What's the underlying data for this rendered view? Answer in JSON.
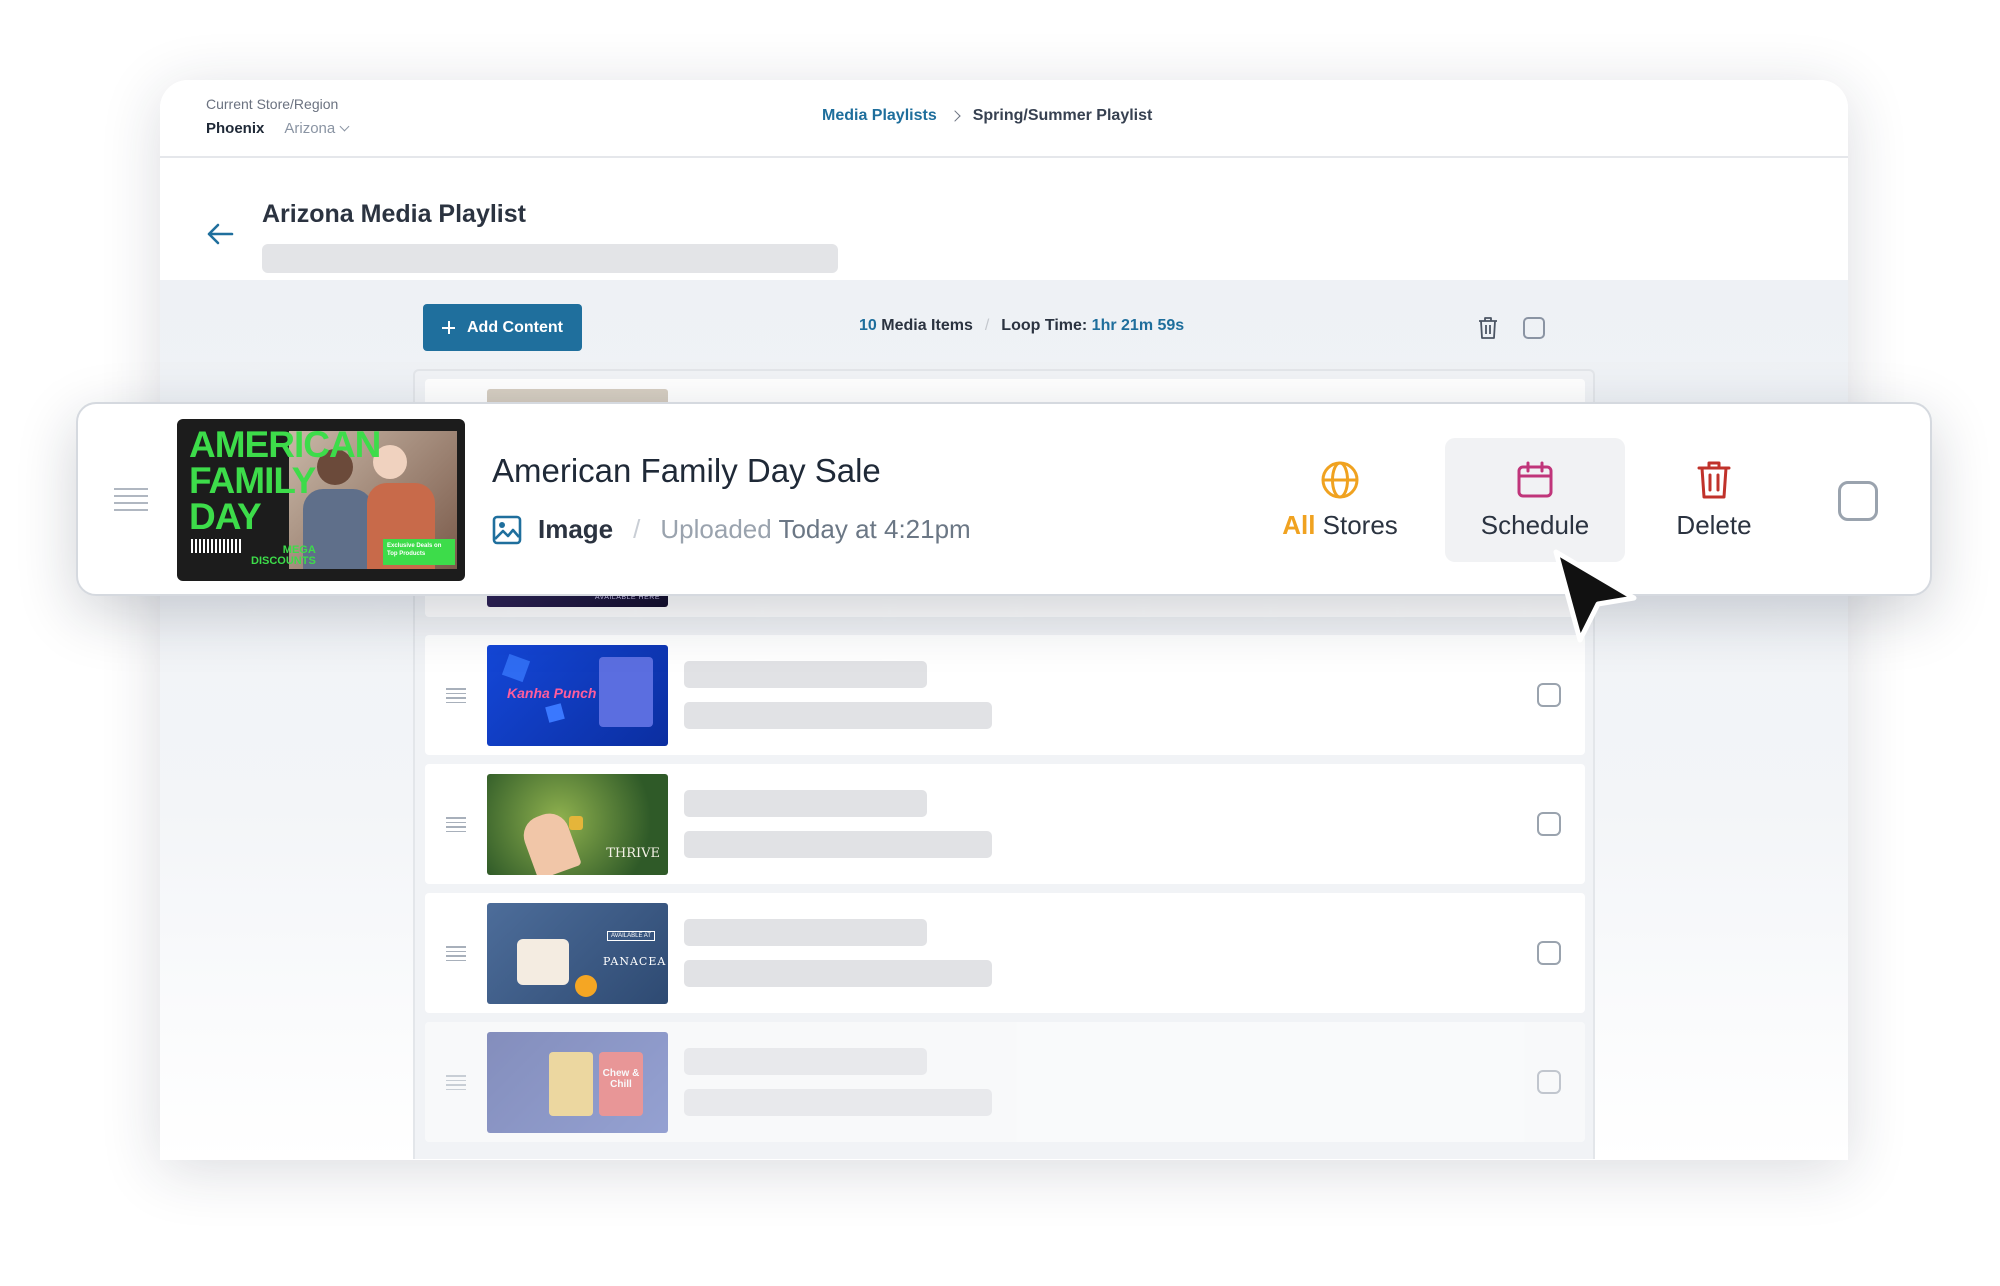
{
  "topbar": {
    "region_label": "Current Store/Region",
    "city": "Phoenix",
    "state": "Arizona",
    "breadcrumb": {
      "parent": "Media Playlists",
      "current": "Spring/Summer Playlist"
    }
  },
  "header": {
    "title": "Arizona Media Playlist"
  },
  "toolbar": {
    "add_label": "Add Content",
    "media_count": "10",
    "media_label": "Media Items",
    "loop_label": "Loop Time:",
    "loop_value": "1hr 21m 59s"
  },
  "selected_item": {
    "title": "American Family Day Sale",
    "type": "Image",
    "uploaded_label": "Uploaded",
    "uploaded_time": "Today at 4:21pm",
    "thumb_text": {
      "line1": "AMERICAN",
      "line2": "FAMILY",
      "line3": "DAY",
      "badge_top": "MEGA",
      "badge_bottom": "DISCOUNTS",
      "note": "Exclusive Deals on Top Products"
    },
    "actions": {
      "stores_highlight": "All",
      "stores_label": "Stores",
      "schedule_label": "Schedule",
      "delete_label": "Delete"
    }
  },
  "rows": [
    {
      "thumb_text": "AVAILABLE HERE"
    },
    {
      "thumb_text": "Kanha Punch"
    },
    {
      "thumb_text": "THRIVE"
    },
    {
      "thumb_text": "PANACEA",
      "thumb_subtext": "AVAILABLE AT"
    },
    {
      "thumb_text": "Chew & Chill"
    }
  ],
  "colors": {
    "primary": "#1f6f9d",
    "link": "#1e6e9c",
    "accent_orange": "#f0a220",
    "schedule_purple": "#c0357a",
    "delete_red": "#c0322b"
  }
}
